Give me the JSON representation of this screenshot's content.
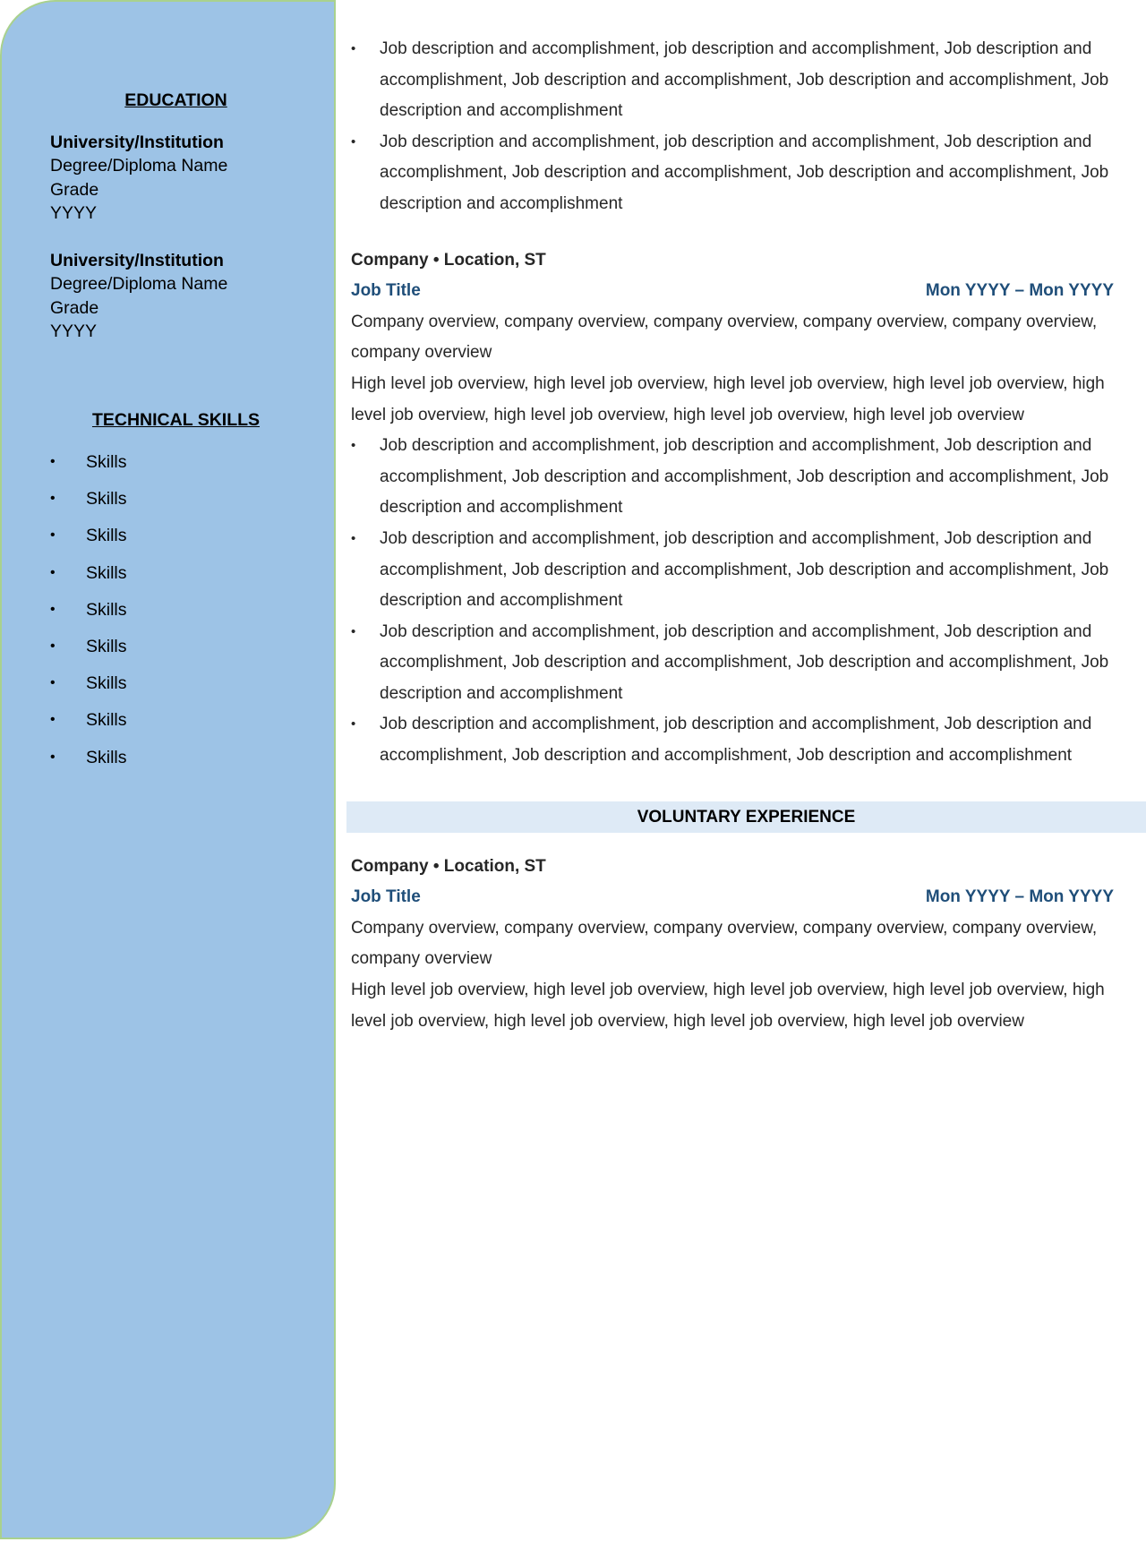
{
  "sidebar": {
    "education": {
      "heading": "EDUCATION",
      "entries": [
        {
          "institution": "University/Institution",
          "degree": "Degree/Diploma Name",
          "grade": "Grade",
          "year": "YYYY"
        },
        {
          "institution": "University/Institution",
          "degree": "Degree/Diploma Name",
          "grade": "Grade",
          "year": "YYYY"
        }
      ]
    },
    "skills": {
      "heading": "TECHNICAL SKILLS",
      "bullet": "•",
      "items": [
        "Skills",
        "Skills",
        "Skills",
        "Skills",
        "Skills",
        "Skills",
        "Skills",
        "Skills",
        "Skills"
      ]
    }
  },
  "main": {
    "bullet": "•",
    "top_bullets": [
      "Job description and accomplishment, job description and accomplishment, Job description and accomplishment, Job description and accomplishment, Job description and accomplishment, Job description and accomplishment",
      "Job description and accomplishment, job description and accomplishment, Job description and accomplishment, Job description and accomplishment, Job description and accomplishment, Job description and accomplishment"
    ],
    "job2": {
      "company": "Company • Location, ST",
      "title": "Job Title",
      "dates": "Mon YYYY – Mon YYYY",
      "company_overview": "Company overview, company overview, company overview, company overview, company overview, company overview",
      "job_overview": "High level job overview, high level job overview, high level job overview, high level job overview, high level job overview, high level job overview, high level job overview, high level job overview",
      "bullets": [
        "Job description and accomplishment, job description and accomplishment, Job description and accomplishment, Job description and accomplishment, Job description and accomplishment, Job description and accomplishment",
        "Job description and accomplishment, job description and accomplishment, Job description and accomplishment, Job description and accomplishment, Job description and accomplishment, Job description and accomplishment",
        "Job description and accomplishment, job description and accomplishment, Job description and accomplishment, Job description and accomplishment, Job description and accomplishment, Job description and accomplishment",
        "Job description and accomplishment, job description and accomplishment, Job description and accomplishment, Job description and accomplishment, Job description and accomplishment"
      ]
    },
    "voluntary": {
      "heading": "VOLUNTARY EXPERIENCE",
      "company": "Company • Location, ST",
      "title": "Job Title",
      "dates": "Mon YYYY – Mon YYYY",
      "company_overview": "Company overview, company overview, company overview, company overview, company overview, company overview",
      "job_overview": "High level job overview, high level job overview, high level job overview, high level job overview, high level job overview, high level job overview, high level job overview, high level job overview"
    }
  },
  "colors": {
    "sidebar_bg": "#9dc3e6",
    "sidebar_border": "#a9d18e",
    "job_title": "#1f4e79",
    "section_band": "#deeaf6"
  }
}
